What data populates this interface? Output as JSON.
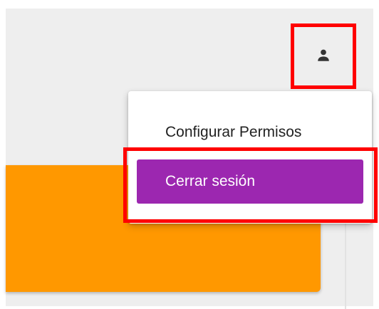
{
  "header": {
    "user_icon": "account-icon"
  },
  "user_menu": {
    "items": [
      {
        "label": "Configurar Permisos",
        "selected": false
      },
      {
        "label": "Cerrar sesión",
        "selected": true
      }
    ]
  },
  "colors": {
    "background": "#eeeeee",
    "card_accent": "#ff9800",
    "selected_item": "#9c27b0",
    "highlight_box": "#ff0000"
  }
}
